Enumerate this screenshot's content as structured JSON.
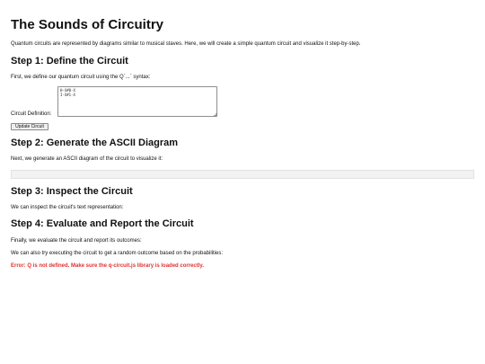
{
  "header": {
    "title": "The Sounds of Circuitry"
  },
  "intro": {
    "text": "Quantum circuits are represented by diagrams similar to musical staves. Here, we will create a simple quantum circuit and visualize it step-by-step."
  },
  "step1": {
    "heading": "Step 1: Define the Circuit",
    "description": "First, we define our quantum circuit using the Q`...` syntax:",
    "definition_label": "Circuit Definition:",
    "definition_value": "H-X#0-X\nI-X#1-X",
    "update_button_label": "Update Circuit"
  },
  "step2": {
    "heading": "Step 2: Generate the ASCII Diagram",
    "description": "Next, we generate an ASCII diagram of the circuit to visualize it:",
    "diagram_text": ""
  },
  "step3": {
    "heading": "Step 3: Inspect the Circuit",
    "description": "We can inspect the circuit's text representation:"
  },
  "step4": {
    "heading": "Step 4: Evaluate and Report the Circuit",
    "description": "Finally, we evaluate the circuit and report its outcomes:",
    "description2": "We can also try executing the circuit to get a random outcome based on the probabilities:",
    "error": "Error: Q is not defined. Make sure the q-circuit.js library is loaded correctly."
  },
  "colors": {
    "error": "#e03131",
    "text": "#111111",
    "diagram_background": "#f2f2f2"
  }
}
